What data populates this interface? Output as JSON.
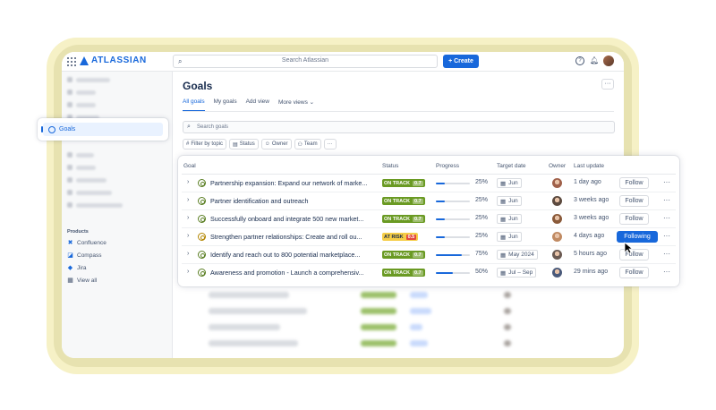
{
  "topbar": {
    "brand": "ATLASSIAN",
    "search_placeholder": "Search Atlassian",
    "create_label": "+ Create"
  },
  "sidebar": {
    "active_item": "Goals",
    "products_heading": "Products",
    "products": [
      {
        "label": "Confluence",
        "icon": "confluence-icon",
        "color": "#1868db"
      },
      {
        "label": "Compass",
        "icon": "compass-icon",
        "color": "#1868db"
      },
      {
        "label": "Jira",
        "icon": "jira-icon",
        "color": "#1868db"
      },
      {
        "label": "View all",
        "icon": "grid-icon",
        "color": "#44546f"
      }
    ]
  },
  "main": {
    "title": "Goals",
    "tabs": [
      "All goals",
      "My goals",
      "Add view",
      "More views"
    ],
    "search_placeholder": "Search goals",
    "filters": [
      "Filter by topic",
      "Status",
      "Owner",
      "Team",
      "···"
    ]
  },
  "table": {
    "columns": {
      "goal": "Goal",
      "status": "Status",
      "progress": "Progress",
      "target": "Target date",
      "owner": "Owner",
      "last_update": "Last update"
    },
    "rows": [
      {
        "goal": "Partnership expansion: Expand our network of marke...",
        "status": "ON TRACK",
        "score": "0.7",
        "state": "track",
        "progress": 25,
        "progress_label": "25%",
        "target": "Jun",
        "last_update": "1 day ago",
        "follow": "Follow",
        "following": false,
        "avatar": "#a0614a"
      },
      {
        "goal": "Partner identification and outreach",
        "status": "ON TRACK",
        "score": "0.7",
        "state": "track",
        "progress": 25,
        "progress_label": "25%",
        "target": "Jun",
        "last_update": "3 weeks ago",
        "follow": "Follow",
        "following": false,
        "avatar": "#5c4a3f"
      },
      {
        "goal": "Successfully onboard and integrate 500 new market...",
        "status": "ON TRACK",
        "score": "0.7",
        "state": "track",
        "progress": 25,
        "progress_label": "25%",
        "target": "Jun",
        "last_update": "3 weeks ago",
        "follow": "Follow",
        "following": false,
        "avatar": "#8a5a3a"
      },
      {
        "goal": "Strengthen partner relationships:  Create and roll ou...",
        "status": "AT RISK",
        "score": "0.5",
        "state": "risk",
        "progress": 25,
        "progress_label": "25%",
        "target": "Jun",
        "last_update": "4 days ago",
        "follow": "Following",
        "following": true,
        "avatar": "#c08a62"
      },
      {
        "goal": "Identify and reach out to 800 potential marketplace...",
        "status": "ON TRACK",
        "score": "0.7",
        "state": "track",
        "progress": 75,
        "progress_label": "75%",
        "target": "May 2024",
        "last_update": "5 hours ago",
        "follow": "Follow",
        "following": false,
        "avatar": "#6b5a52"
      },
      {
        "goal": "Awareness and promotion - Launch a comprehensiv...",
        "status": "ON TRACK",
        "score": "0.7",
        "state": "track",
        "progress": 50,
        "progress_label": "50%",
        "target": "Jul – Sep",
        "last_update": "29 mins ago",
        "follow": "Follow",
        "following": false,
        "avatar": "#4a5a7a"
      }
    ]
  },
  "colors": {
    "brand": "#1868db",
    "on_track": "#6a9a23",
    "at_risk": "#f5cd47",
    "frame": "#e7e2b0"
  }
}
